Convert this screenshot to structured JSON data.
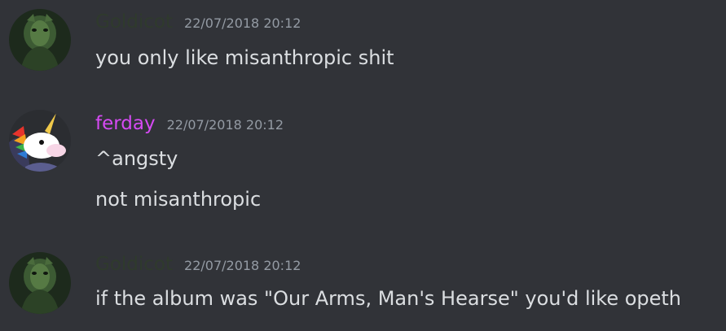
{
  "colors": {
    "background": "#313338",
    "text": "#dbdee1",
    "timestamp": "#949ba4",
    "goldicot_name": "#2f3a2d",
    "ferday_name": "#d64af4"
  },
  "messages": [
    {
      "author": "Goldicot",
      "timestamp": "22/07/2018 20:12",
      "avatar_icon": "green-creature-avatar-icon",
      "lines": [
        "you only like misanthropic shit"
      ]
    },
    {
      "author": "ferday",
      "timestamp": "22/07/2018 20:12",
      "avatar_icon": "unicorn-avatar-icon",
      "lines": [
        "^angsty",
        "not misanthropic"
      ]
    },
    {
      "author": "Goldicot",
      "timestamp": "22/07/2018 20:12",
      "avatar_icon": "green-creature-avatar-icon",
      "lines": [
        "if the album was \"Our Arms, Man's Hearse\" you'd like opeth"
      ]
    }
  ]
}
